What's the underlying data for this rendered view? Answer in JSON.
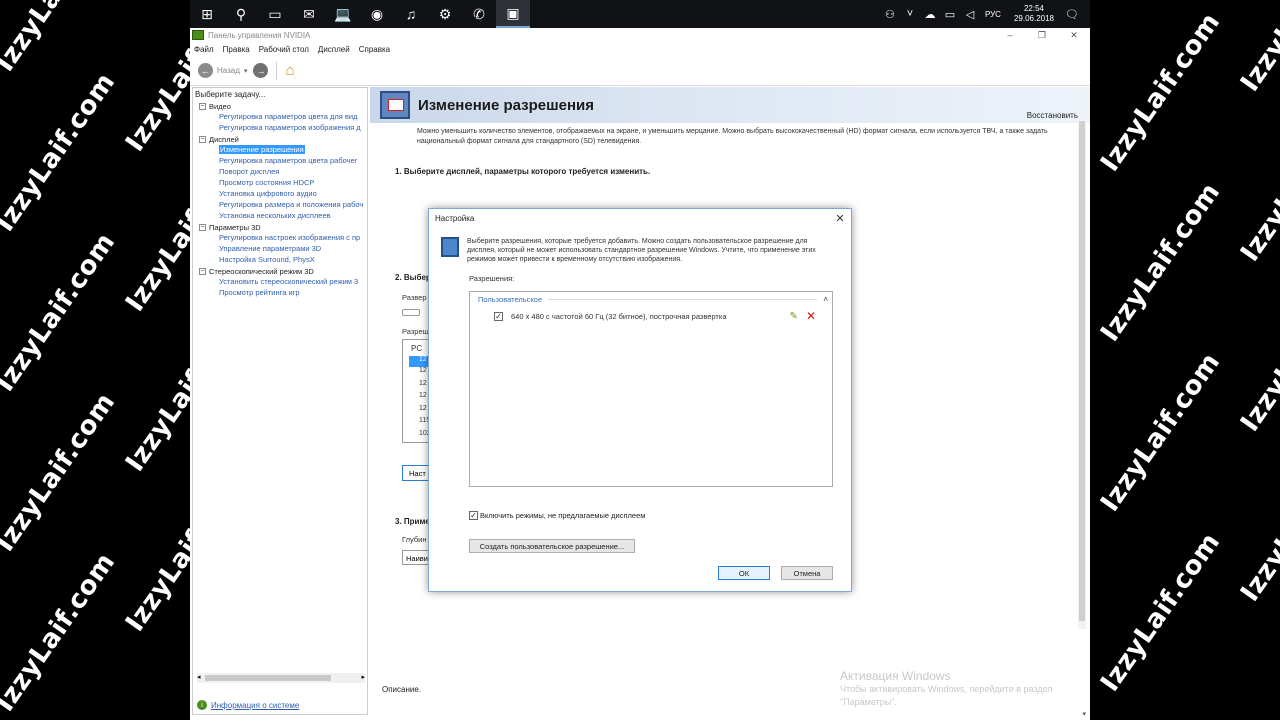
{
  "watermark": "IzzyLaif.com",
  "taskbar": {
    "time": "22:54",
    "date": "29.06.2018",
    "lang": "РУС"
  },
  "window": {
    "title": "Панель управления NVIDIA",
    "menu": [
      "Файл",
      "Правка",
      "Рабочий стол",
      "Дисплей",
      "Справка"
    ],
    "back_label": "Назад"
  },
  "sidebar": {
    "header": "Выберите задачу...",
    "categories": [
      {
        "label": "Видео",
        "items": [
          "Регулировка параметров цвета для вид",
          "Регулировка параметров изображения д"
        ]
      },
      {
        "label": "Дисплей",
        "items": [
          "Изменение разрешения",
          "Регулировка параметров цвета рабочег",
          "Поворот дисплея",
          "Просмотр состояния HDCP",
          "Установка цифрового аудио",
          "Регулировка размера и положения рабоч",
          "Установка нескольких дисплеев"
        ]
      },
      {
        "label": "Параметры 3D",
        "items": [
          "Регулировка настроек изображения с пр",
          "Управление параметрами 3D",
          "Настройка Surround, PhysX"
        ]
      },
      {
        "label": "Стереоскопический режим 3D",
        "items": [
          "Установить стереоскопический режим 3",
          "Просмотр рейтинга игр"
        ]
      }
    ],
    "system_info": "Информация о системе"
  },
  "page": {
    "title": "Изменение разрешения",
    "restore": "Восстановить",
    "description": "Можно уменьшить количество элементов, отображаемых на экране, и уменьшить мерцание. Можно выбрать высококачественный (HD) формат сигнала, если используется ТВЧ, а также задать национальный формат сигнала для стандартного (SD) телевидения.",
    "step1": "1. Выберите дисплей, параметры которого требуется изменить.",
    "step2": "2. Выбер",
    "step2_label_a": "Развер",
    "step2_label_b": "Разреше",
    "pc": "PC",
    "res_partial": [
      "12",
      "12",
      "12",
      "12",
      "12",
      "115",
      "102"
    ],
    "custom_btn_partial": "Наст",
    "step3": "3. Приме",
    "depth_label": "Глубин",
    "depth_value": "Наиви",
    "description_label": "Описание."
  },
  "activation": {
    "title": "Активация Windows",
    "text": "Чтобы активировать Windows, перейдите в раздел \"Параметры\"."
  },
  "dialog": {
    "title": "Настройка",
    "info": "Выберите разрешения, которые требуется добавить. Можно создать пользовательское разрешение для дисплея, который не может использовать стандартное разрешение Windows. Учтите, что применение этих режимов может привести к временному отсутствию изображения.",
    "resolutions_label": "Разрешения:",
    "group": "Пользовательское",
    "item": "640 x 480 с частотой 60 Гц (32 битное), построчная развертка",
    "enable_modes": "Включить режимы, не предлагаемые дисплеем",
    "create_btn": "Создать пользовательское разрешение...",
    "ok": "ОК",
    "cancel": "Отмена"
  }
}
